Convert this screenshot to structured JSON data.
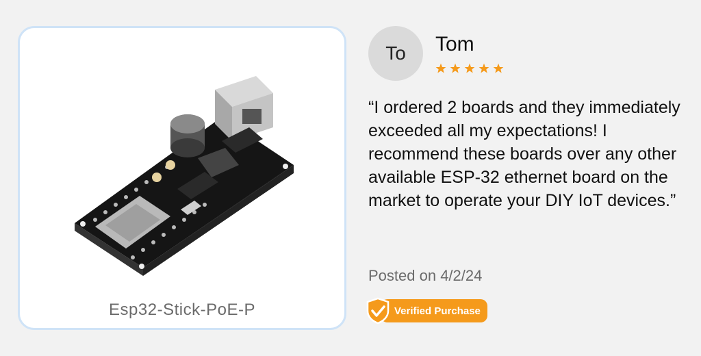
{
  "product": {
    "name": "Esp32-Stick-PoE-P",
    "image": "esp32-stick-poe-board-photo"
  },
  "reviewer": {
    "initials": "To",
    "name": "Tom",
    "rating": 5,
    "max_rating": 5
  },
  "review": {
    "text": "“I ordered 2 boards and they immediately exceeded all my expectations! I recommend these boards over any other available ESP-32 ethernet board on the market to operate your DIY IoT devices.”",
    "posted": "Posted on 4/2/24"
  },
  "badge": {
    "label": "Verified Purchase",
    "icon": "shield-check-icon"
  },
  "colors": {
    "accent": "#f59a1b",
    "card_border": "#cfe3f7",
    "background": "#f2f2f2"
  }
}
